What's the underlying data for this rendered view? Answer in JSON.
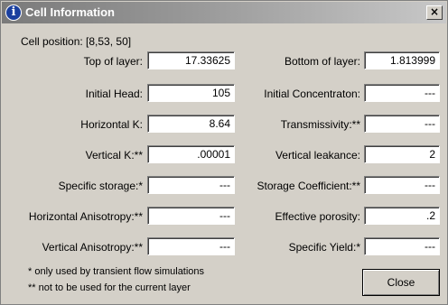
{
  "window": {
    "title": "Cell Information",
    "close_glyph": "×"
  },
  "cell_position": "Cell position: [8,53, 50]",
  "left_fields": [
    {
      "label": "Top of layer:",
      "value": "17.33625"
    },
    {
      "label": "Initial Head:",
      "value": "105"
    },
    {
      "label": "Horizontal K:",
      "value": "8.64"
    },
    {
      "label": "Vertical K:**",
      "value": ".00001"
    },
    {
      "label": "Specific storage:*",
      "value": "---"
    },
    {
      "label": "Horizontal Anisotropy:**",
      "value": "---"
    },
    {
      "label": "Vertical Anisotropy:**",
      "value": "---"
    }
  ],
  "right_fields": [
    {
      "label": "Bottom of layer:",
      "value": "1.813999"
    },
    {
      "label": "Initial Concentraton:",
      "value": "---"
    },
    {
      "label": "Transmissivity:**",
      "value": "---"
    },
    {
      "label": "Vertical leakance:",
      "value": "2"
    },
    {
      "label": "Storage Coefficient:**",
      "value": "---"
    },
    {
      "label": "Effective porosity:",
      "value": ".2"
    },
    {
      "label": "Specific Yield:*",
      "value": "---"
    }
  ],
  "notes": {
    "transient": "* only used by transient flow simulations",
    "not_current": "** not to be used for the current layer"
  },
  "close_button": "Close",
  "icons": {
    "title_icon": "info-icon",
    "close_icon": "close-icon"
  }
}
